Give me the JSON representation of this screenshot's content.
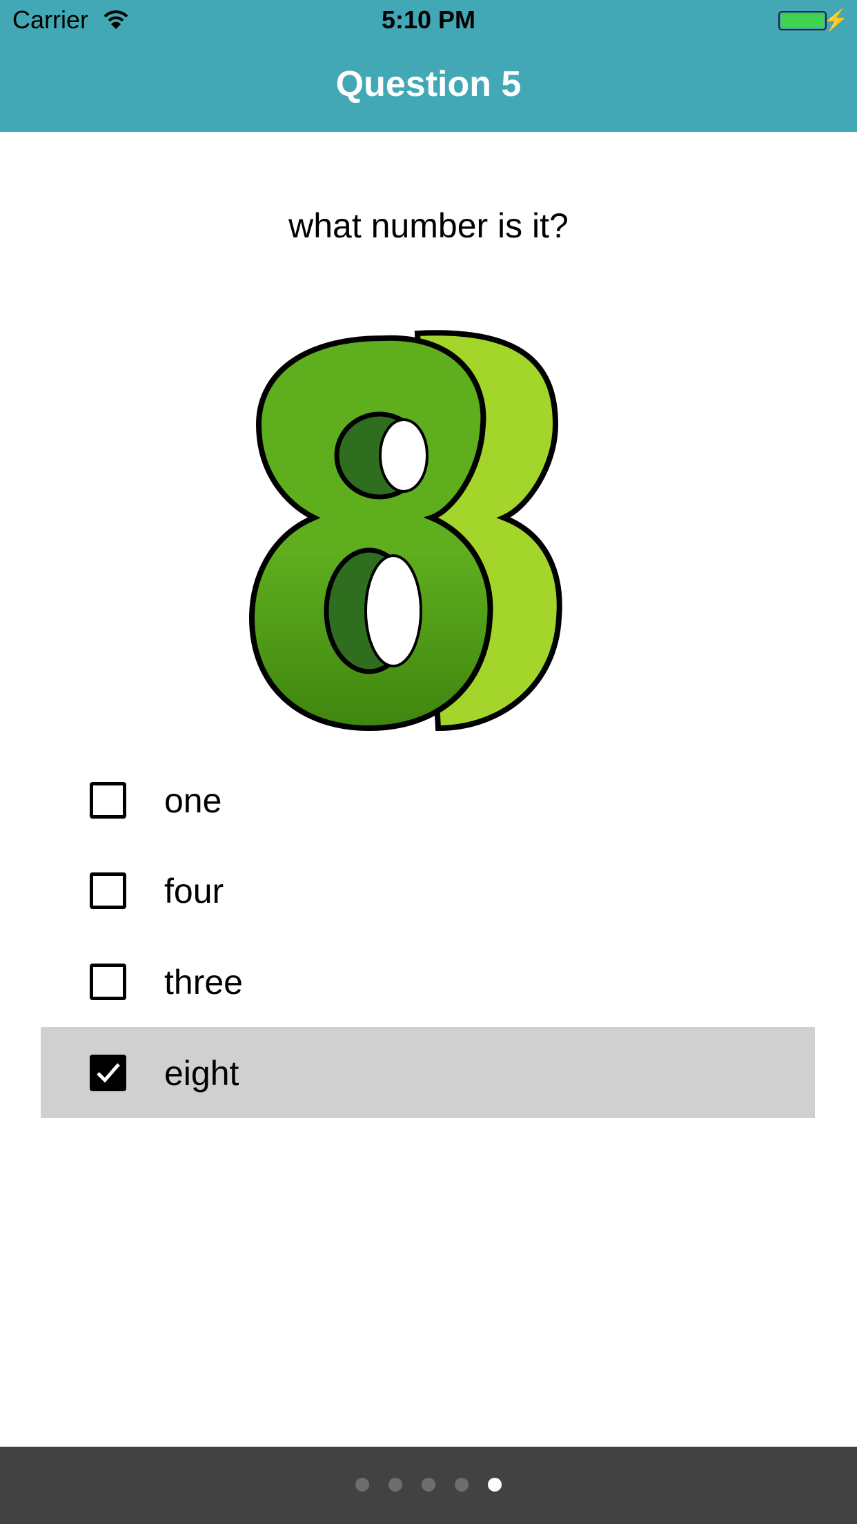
{
  "status_bar": {
    "carrier": "Carrier",
    "time": "5:10 PM",
    "battery_percent": 100
  },
  "nav": {
    "title": "Question 5"
  },
  "question": {
    "text": "what number is it?",
    "image_icon": "number-eight-image"
  },
  "options": [
    {
      "label": "one",
      "checked": false
    },
    {
      "label": "four",
      "checked": false
    },
    {
      "label": "three",
      "checked": false
    },
    {
      "label": "eight",
      "checked": true
    }
  ],
  "pager": {
    "total": 5,
    "current": 5
  },
  "colors": {
    "header": "#43a8b5",
    "footer": "#424242",
    "selected_row": "#d0d0d0"
  }
}
